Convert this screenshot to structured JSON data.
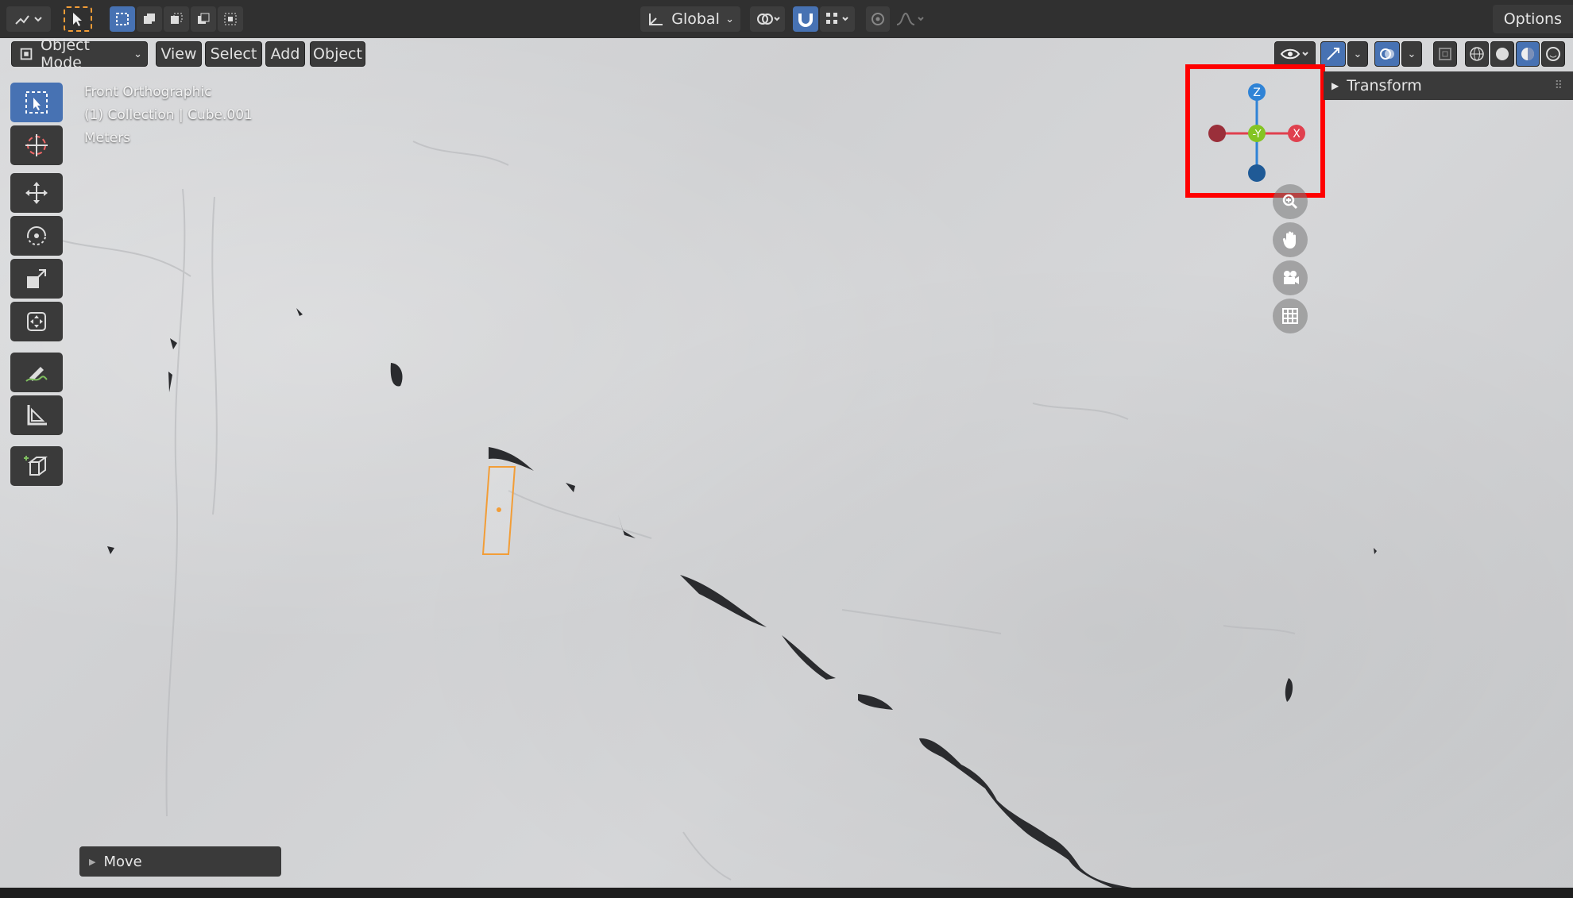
{
  "header": {
    "orientation_label": "Global",
    "options_label": "Options"
  },
  "viewport_header": {
    "mode_label": "Object Mode",
    "menu": [
      "View",
      "Select",
      "Add",
      "Object"
    ]
  },
  "overlay": {
    "view_name": "Front Orthographic",
    "collection": "(1) Collection | Cube.001",
    "units": "Meters"
  },
  "gizmo": {
    "z_label": "Z",
    "y_label": "-Y",
    "x_label": "X",
    "highlight_color": "#ff0000",
    "x_color": "#e0404e",
    "y_color": "#84c423",
    "z_color": "#2f83d6"
  },
  "sidebar": {
    "transform_label": "Transform"
  },
  "operator_panel": {
    "label": "Move"
  },
  "colors": {
    "accent": "#4772b3",
    "selection": "#f29d37"
  }
}
